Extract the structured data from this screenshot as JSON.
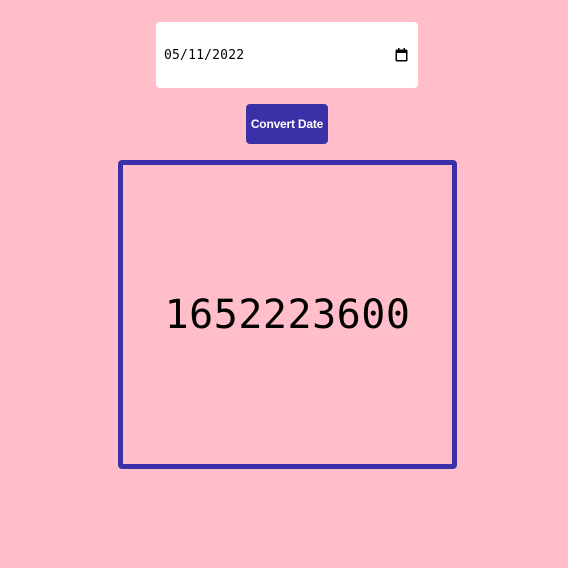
{
  "date_input": {
    "value": "05/11/2022",
    "icon": "calendar-icon"
  },
  "convert_button": {
    "label": "Convert Date"
  },
  "result": {
    "value": "1652223600"
  },
  "colors": {
    "background": "#ffbec9",
    "accent": "#3a31a8",
    "input_background": "#ffffff",
    "text": "#000000"
  }
}
